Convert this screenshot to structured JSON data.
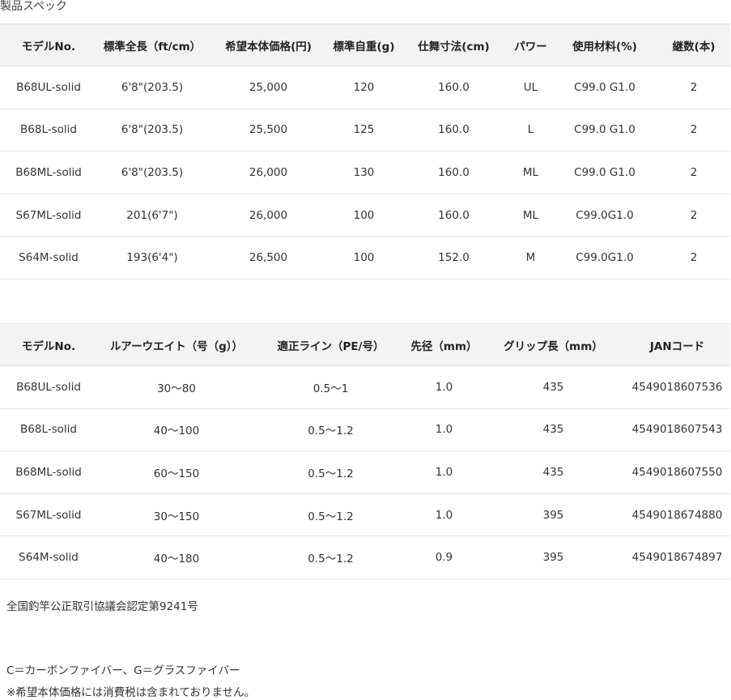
{
  "heading": "製品スペック",
  "spec_table": {
    "headers": [
      "モデルNo.",
      "標準全長（ft/cm）",
      "希望本体価格(円)",
      "標準自重(g)",
      "仕舞寸法(cm)",
      "パワー",
      "使用材料(%)",
      "継数(本)"
    ],
    "rows": [
      [
        "B68UL-solid",
        "6'8\"(203.5)",
        "25,000",
        "120",
        "160.0",
        "UL",
        "C99.0 G1.0",
        "2"
      ],
      [
        "B68L-solid",
        "6'8\"(203.5)",
        "25,500",
        "125",
        "160.0",
        "L",
        "C99.0 G1.0",
        "2"
      ],
      [
        "B68ML-solid",
        "6'8\"(203.5)",
        "26,000",
        "130",
        "160.0",
        "ML",
        "C99.0 G1.0",
        "2"
      ],
      [
        "S67ML-solid",
        "201(6'7\")",
        "26,000",
        "100",
        "160.0",
        "ML",
        "C99.0G1.0",
        "2"
      ],
      [
        "S64M-solid",
        "193(6'4\")",
        "26,500",
        "100",
        "152.0",
        "M",
        "C99.0G1.0",
        "2"
      ]
    ]
  },
  "line_table": {
    "headers": [
      "モデルNo.",
      "ルアーウエイト（号（g））",
      "適正ライン（PE/号）",
      "先径（mm）",
      "グリップ長（mm）",
      "JANコード"
    ],
    "rows": [
      [
        "B68UL-solid",
        "30～80",
        "0.5～1",
        "1.0",
        "435",
        "4549018607536"
      ],
      [
        "B68L-solid",
        "40～100",
        "0.5～1.2",
        "1.0",
        "435",
        "4549018607543"
      ],
      [
        "B68ML-solid",
        "60～150",
        "0.5～1.2",
        "1.0",
        "435",
        "4549018607550"
      ],
      [
        "S67ML-solid",
        "30～150",
        "0.5～1.2",
        "1.0",
        "395",
        "4549018674880"
      ],
      [
        "S64M-solid",
        "40～180",
        "0.5～1.2",
        "0.9",
        "395",
        "4549018674897"
      ]
    ]
  },
  "notes": {
    "certification": "全国釣竿公正取引協議会認定第9241号",
    "materials": "C＝カーボンファイバー、G＝グラスファイバー",
    "tax": "※希望本体価格には消費税は含まれておりません。"
  }
}
